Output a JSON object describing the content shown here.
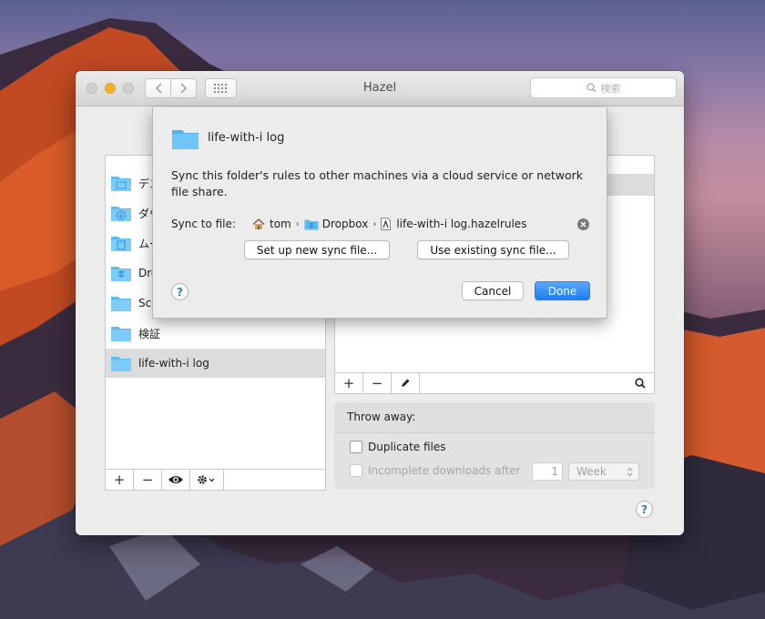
{
  "window": {
    "title": "Hazel",
    "search_placeholder": "検索",
    "back_icon": "chevron-left-icon",
    "forward_icon": "chevron-right-icon",
    "grid_icon": "grid-icon"
  },
  "folders": [
    {
      "label": "デス",
      "icon": "folder-icon"
    },
    {
      "label": "ダウ",
      "icon": "downloads-folder-icon"
    },
    {
      "label": "ムー",
      "icon": "movies-folder-icon"
    },
    {
      "label": "Dro",
      "icon": "dropbox-folder-icon"
    },
    {
      "label": "Scr",
      "icon": "folder-icon"
    },
    {
      "label": "検証",
      "icon": "folder-icon"
    },
    {
      "label": "life-with-i log",
      "icon": "folder-icon",
      "selected": true
    }
  ],
  "left_toolbar": {
    "add": "+",
    "remove": "−",
    "eye": "eye-icon",
    "gear": "gear-icon"
  },
  "right_toolbar": {
    "add": "+",
    "remove": "−",
    "edit": "pencil-icon",
    "search": "search-icon"
  },
  "throw_away": {
    "header": "Throw away:",
    "duplicate_label": "Duplicate files",
    "incomplete_label": "Incomplete downloads after",
    "incomplete_value": "1",
    "incomplete_unit": "Week"
  },
  "sheet": {
    "folder_name": "life-with-i log",
    "description": "Sync this folder's rules to other machines via a cloud service or network file share.",
    "sync_label": "Sync to file:",
    "path": [
      {
        "label": "tom",
        "icon": "home-icon"
      },
      {
        "label": "Dropbox",
        "icon": "dropbox-folder-icon"
      },
      {
        "label": "life-with-i log.hazelrules",
        "icon": "rules-file-icon"
      }
    ],
    "setup_button": "Set up new sync file...",
    "existing_button": "Use existing sync file...",
    "cancel_button": "Cancel",
    "done_button": "Done",
    "help": "?"
  },
  "window_help": "?",
  "colors": {
    "accent": "#1c7ef2",
    "folder": "#5bbcf5",
    "selected_row": "#dcdcdc"
  }
}
